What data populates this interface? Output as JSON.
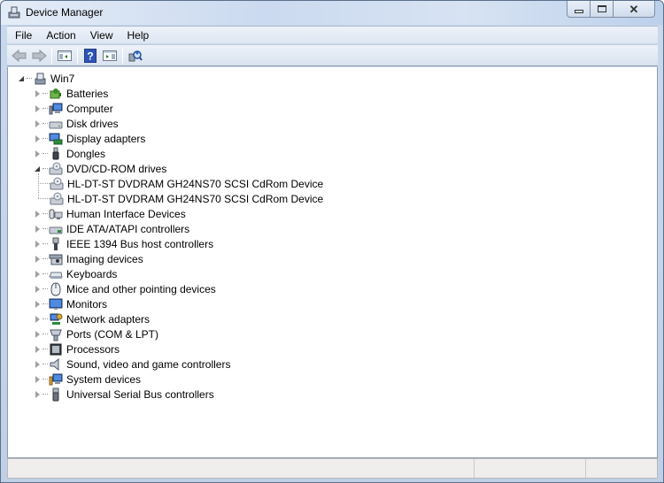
{
  "window": {
    "title": "Device Manager",
    "title_icon": "device-manager-icon",
    "caption_buttons": [
      "minimize",
      "maximize",
      "close"
    ]
  },
  "menu": {
    "items": [
      {
        "label": "File"
      },
      {
        "label": "Action"
      },
      {
        "label": "View"
      },
      {
        "label": "Help"
      }
    ]
  },
  "toolbar": {
    "buttons": [
      {
        "name": "back",
        "icon": "back-arrow-icon",
        "enabled": false
      },
      {
        "name": "forward",
        "icon": "forward-arrow-icon",
        "enabled": false
      },
      {
        "name": "show-hide-console-tree",
        "icon": "console-tree-icon"
      },
      {
        "name": "help",
        "icon": "help-icon"
      },
      {
        "name": "show-hide-action-pane",
        "icon": "action-pane-icon"
      },
      {
        "name": "scan-hardware-changes",
        "icon": "scan-hardware-icon"
      }
    ]
  },
  "tree": {
    "root": {
      "label": "Win7",
      "expanded": true,
      "icon": "computer-tower-icon"
    },
    "categories": [
      {
        "label": "Batteries",
        "icon": "battery-icon",
        "expanded": false
      },
      {
        "label": "Computer",
        "icon": "computer-icon",
        "expanded": false
      },
      {
        "label": "Disk drives",
        "icon": "disk-drive-icon",
        "expanded": false
      },
      {
        "label": "Display adapters",
        "icon": "display-adapter-icon",
        "expanded": false
      },
      {
        "label": "Dongles",
        "icon": "dongle-icon",
        "expanded": false
      },
      {
        "label": "DVD/CD-ROM drives",
        "icon": "dvd-drive-icon",
        "expanded": true,
        "children": [
          {
            "label": "HL-DT-ST DVDRAM GH24NS70 SCSI CdRom Device",
            "icon": "dvd-drive-icon"
          },
          {
            "label": "HL-DT-ST DVDRAM GH24NS70 SCSI CdRom Device",
            "icon": "dvd-drive-icon"
          }
        ]
      },
      {
        "label": "Human Interface Devices",
        "icon": "hid-icon",
        "expanded": false
      },
      {
        "label": "IDE ATA/ATAPI controllers",
        "icon": "ide-controller-icon",
        "expanded": false
      },
      {
        "label": "IEEE 1394 Bus host controllers",
        "icon": "ieee1394-icon",
        "expanded": false
      },
      {
        "label": "Imaging devices",
        "icon": "imaging-device-icon",
        "expanded": false
      },
      {
        "label": "Keyboards",
        "icon": "keyboard-icon",
        "expanded": false
      },
      {
        "label": "Mice and other pointing devices",
        "icon": "mouse-icon",
        "expanded": false
      },
      {
        "label": "Monitors",
        "icon": "monitor-icon",
        "expanded": false
      },
      {
        "label": "Network adapters",
        "icon": "network-adapter-icon",
        "expanded": false
      },
      {
        "label": "Ports (COM & LPT)",
        "icon": "port-icon",
        "expanded": false
      },
      {
        "label": "Processors",
        "icon": "processor-icon",
        "expanded": false
      },
      {
        "label": "Sound, video and game controllers",
        "icon": "speaker-icon",
        "expanded": false
      },
      {
        "label": "System devices",
        "icon": "system-device-icon",
        "expanded": false
      },
      {
        "label": "Universal Serial Bus controllers",
        "icon": "usb-icon",
        "expanded": false
      }
    ]
  },
  "statusbar": {
    "cells": [
      "",
      "",
      ""
    ]
  }
}
